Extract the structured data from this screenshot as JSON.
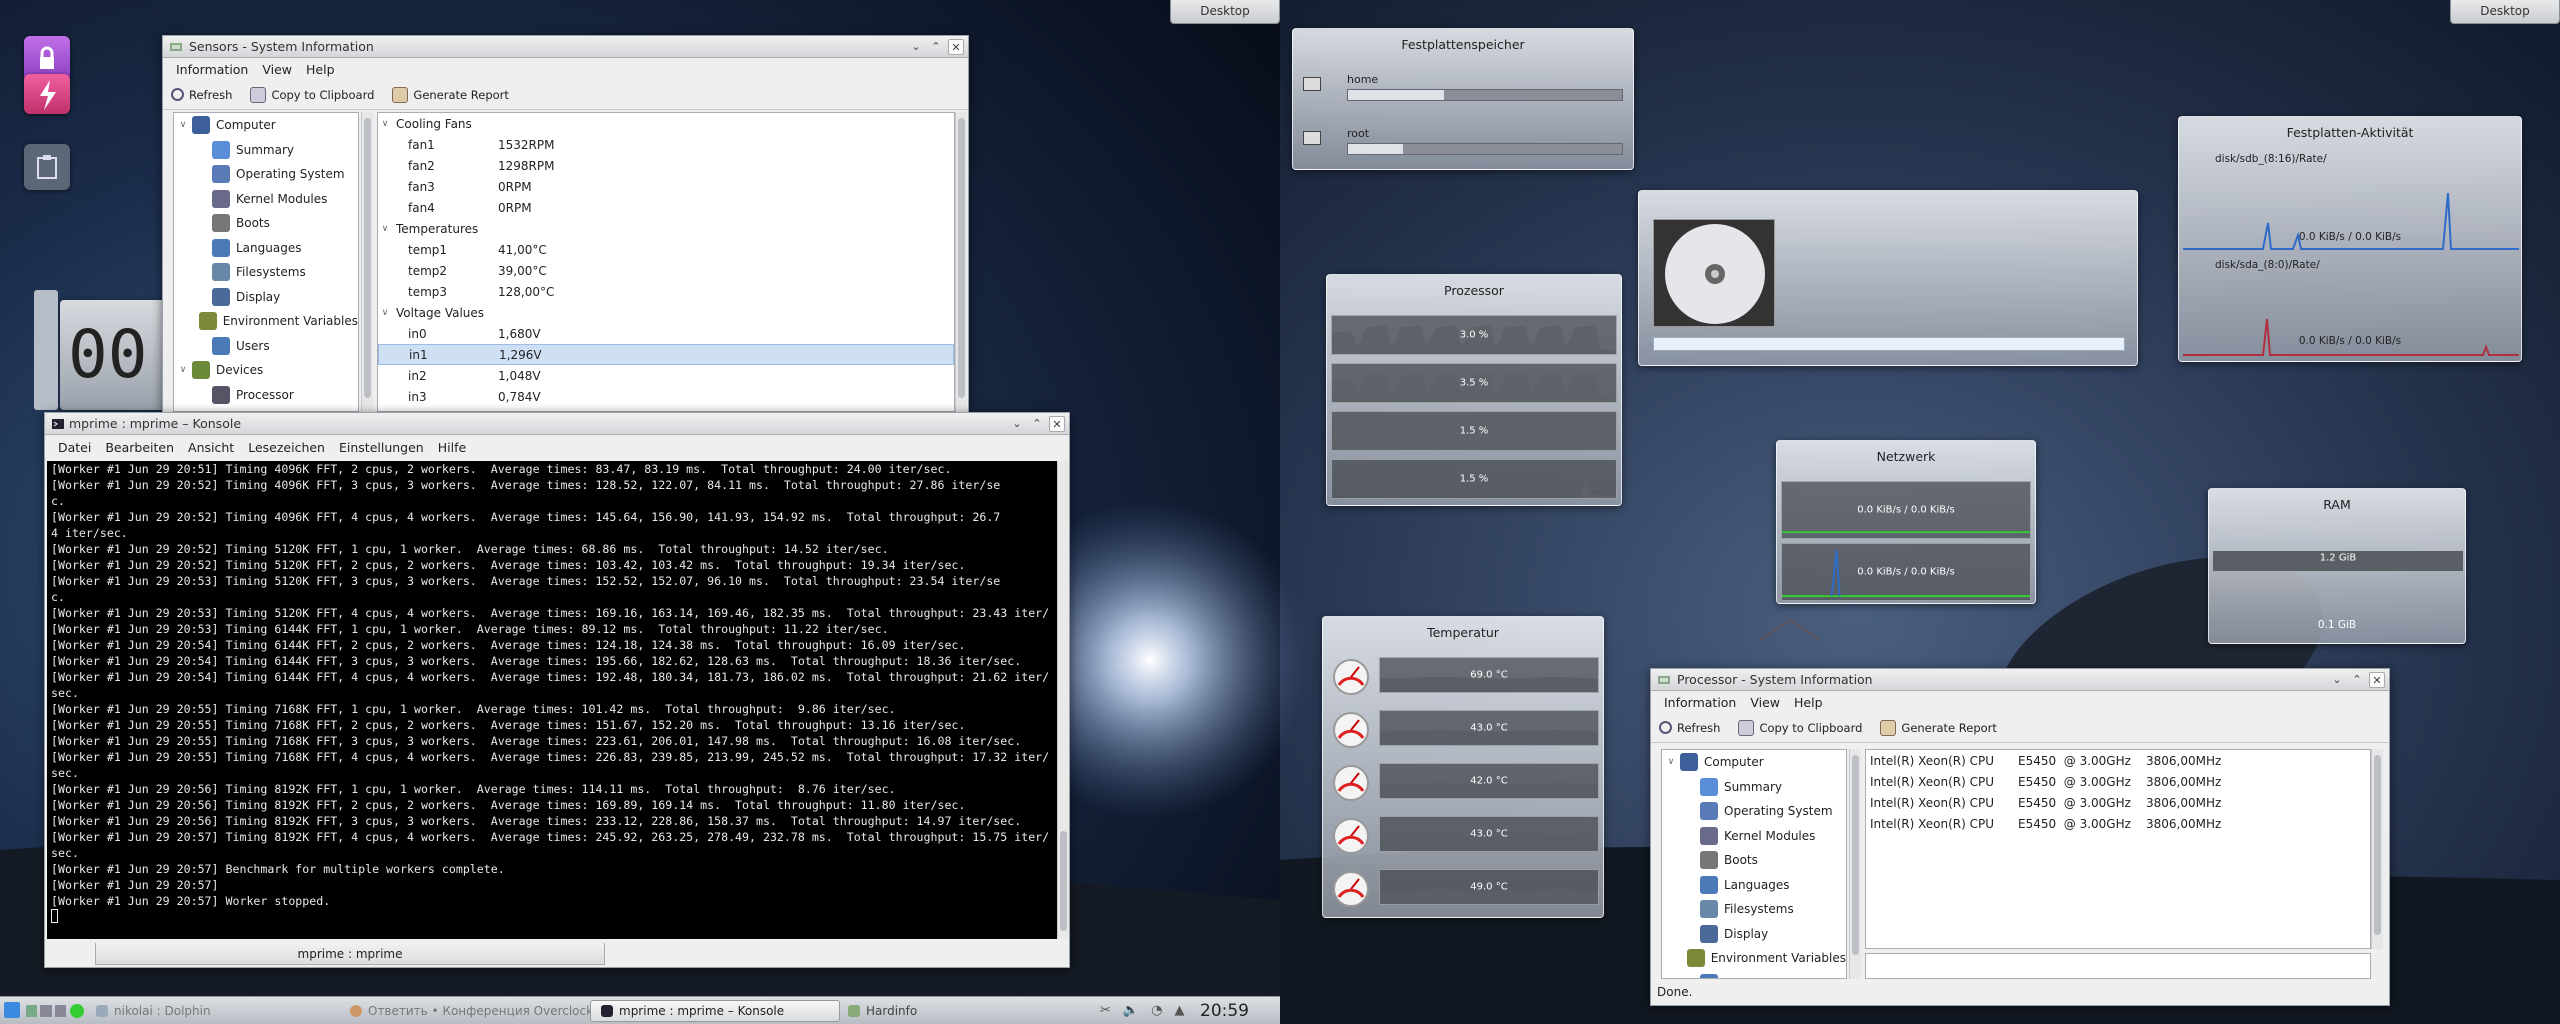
{
  "desktop_buttons": [
    "Desktop",
    "Desktop"
  ],
  "sensors_win": {
    "title": "Sensors - System Information",
    "menu": [
      "Information",
      "View",
      "Help"
    ],
    "toolbar": [
      "Refresh",
      "Copy to Clipboard",
      "Generate Report"
    ],
    "tree": [
      {
        "label": "Computer",
        "level": 0,
        "ex": "v"
      },
      {
        "label": "Summary",
        "level": 1
      },
      {
        "label": "Operating System",
        "level": 1
      },
      {
        "label": "Kernel Modules",
        "level": 1
      },
      {
        "label": "Boots",
        "level": 1
      },
      {
        "label": "Languages",
        "level": 1
      },
      {
        "label": "Filesystems",
        "level": 1
      },
      {
        "label": "Display",
        "level": 1
      },
      {
        "label": "Environment Variables",
        "level": 1
      },
      {
        "label": "Users",
        "level": 1
      },
      {
        "label": "Devices",
        "level": 0,
        "ex": "v"
      },
      {
        "label": "Processor",
        "level": 1
      }
    ],
    "sensors": [
      {
        "group": "Cooling Fans"
      },
      {
        "name": "fan1",
        "value": "1532RPM"
      },
      {
        "name": "fan2",
        "value": "1298RPM"
      },
      {
        "name": "fan3",
        "value": "0RPM"
      },
      {
        "name": "fan4",
        "value": "0RPM"
      },
      {
        "group": "Temperatures"
      },
      {
        "name": "temp1",
        "value": "41,00°C"
      },
      {
        "name": "temp2",
        "value": "39,00°C"
      },
      {
        "name": "temp3",
        "value": "128,00°C"
      },
      {
        "group": "Voltage Values"
      },
      {
        "name": "in0",
        "value": "1,680V"
      },
      {
        "name": "in1",
        "value": "1,296V",
        "selected": true
      },
      {
        "name": "in2",
        "value": "1,048V"
      },
      {
        "name": "in3",
        "value": "0,784V"
      }
    ]
  },
  "konsole": {
    "title": "mprime : mprime – Konsole",
    "menu": [
      "Datei",
      "Bearbeiten",
      "Ansicht",
      "Lesezeichen",
      "Einstellungen",
      "Hilfe"
    ],
    "tab": "mprime : mprime",
    "lines": [
      "[Worker #1 Jun 29 20:51] Timing 4096K FFT, 2 cpus, 2 workers.  Average times: 83.47, 83.19 ms.  Total throughput: 24.00 iter/sec.",
      "[Worker #1 Jun 29 20:52] Timing 4096K FFT, 3 cpus, 3 workers.  Average times: 128.52, 122.07, 84.11 ms.  Total throughput: 27.86 iter/se",
      "c.",
      "[Worker #1 Jun 29 20:52] Timing 4096K FFT, 4 cpus, 4 workers.  Average times: 145.64, 156.90, 141.93, 154.92 ms.  Total throughput: 26.7",
      "4 iter/sec.",
      "[Worker #1 Jun 29 20:52] Timing 5120K FFT, 1 cpu, 1 worker.  Average times: 68.86 ms.  Total throughput: 14.52 iter/sec.",
      "[Worker #1 Jun 29 20:52] Timing 5120K FFT, 2 cpus, 2 workers.  Average times: 103.42, 103.42 ms.  Total throughput: 19.34 iter/sec.",
      "[Worker #1 Jun 29 20:53] Timing 5120K FFT, 3 cpus, 3 workers.  Average times: 152.52, 152.07, 96.10 ms.  Total throughput: 23.54 iter/se",
      "c.",
      "[Worker #1 Jun 29 20:53] Timing 5120K FFT, 4 cpus, 4 workers.  Average times: 169.16, 163.14, 169.46, 182.35 ms.  Total throughput: 23.43 iter/",
      "[Worker #1 Jun 29 20:53] Timing 6144K FFT, 1 cpu, 1 worker.  Average times: 89.12 ms.  Total throughput: 11.22 iter/sec.",
      "[Worker #1 Jun 29 20:54] Timing 6144K FFT, 2 cpus, 2 workers.  Average times: 124.18, 124.38 ms.  Total throughput: 16.09 iter/sec.",
      "[Worker #1 Jun 29 20:54] Timing 6144K FFT, 3 cpus, 3 workers.  Average times: 195.66, 182.62, 128.63 ms.  Total throughput: 18.36 iter/sec.",
      "[Worker #1 Jun 29 20:54] Timing 6144K FFT, 4 cpus, 4 workers.  Average times: 192.48, 180.34, 181.73, 186.02 ms.  Total throughput: 21.62 iter/",
      "sec.",
      "[Worker #1 Jun 29 20:55] Timing 7168K FFT, 1 cpu, 1 worker.  Average times: 101.42 ms.  Total throughput:  9.86 iter/sec.",
      "[Worker #1 Jun 29 20:55] Timing 7168K FFT, 2 cpus, 2 workers.  Average times: 151.67, 152.20 ms.  Total throughput: 13.16 iter/sec.",
      "[Worker #1 Jun 29 20:55] Timing 7168K FFT, 3 cpus, 3 workers.  Average times: 223.61, 206.01, 147.98 ms.  Total throughput: 16.08 iter/sec.",
      "[Worker #1 Jun 29 20:55] Timing 7168K FFT, 4 cpus, 4 workers.  Average times: 226.83, 239.85, 213.99, 245.52 ms.  Total throughput: 17.32 iter/",
      "sec.",
      "[Worker #1 Jun 29 20:56] Timing 8192K FFT, 1 cpu, 1 worker.  Average times: 114.11 ms.  Total throughput:  8.76 iter/sec.",
      "[Worker #1 Jun 29 20:56] Timing 8192K FFT, 2 cpus, 2 workers.  Average times: 169.89, 169.14 ms.  Total throughput: 11.80 iter/sec.",
      "[Worker #1 Jun 29 20:56] Timing 8192K FFT, 3 cpus, 3 workers.  Average times: 233.12, 228.86, 158.37 ms.  Total throughput: 14.97 iter/sec.",
      "[Worker #1 Jun 29 20:57] Timing 8192K FFT, 4 cpus, 4 workers.  Average times: 245.92, 263.25, 278.49, 232.78 ms.  Total throughput: 15.75 iter/",
      "sec.",
      "[Worker #1 Jun 29 20:57] Benchmark for multiple workers complete.",
      "[Worker #1 Jun 29 20:57]",
      "[Worker #1 Jun 29 20:57] Worker stopped.",
      ""
    ]
  },
  "taskbar": {
    "tasks": [
      "nikolai : Dolphin",
      "Ответить • Конференция Overclock...",
      "mprime : mprime – Konsole",
      "Hardinfo"
    ],
    "clock": "20:59"
  },
  "widgets": {
    "disk_space": {
      "title": "Festplattenspeicher",
      "items": [
        {
          "name": "home",
          "fill": 0.35
        },
        {
          "name": "root",
          "fill": 0.2
        }
      ]
    },
    "disk_activity": {
      "title": "Festplatten-Aktivität",
      "items": [
        {
          "name": "disk/sdb_(8:16)/Rate/",
          "rate": "0.0 KiB/s / 0.0 KiB/s"
        },
        {
          "name": "disk/sda_(8:0)/Rate/",
          "rate": "0.0 KiB/s / 0.0 KiB/s"
        }
      ]
    },
    "cpu": {
      "title": "Prozessor",
      "values": [
        "3.0 %",
        "3.5 %",
        "1.5 %",
        "1.5 %"
      ]
    },
    "network": {
      "title": "Netzwerk",
      "values": [
        "0.0 KiB/s / 0.0 KiB/s",
        "0.0 KiB/s / 0.0 KiB/s"
      ]
    },
    "ram": {
      "title": "RAM",
      "values": [
        "1.2 GiB",
        "0.1 GiB"
      ]
    },
    "temp": {
      "title": "Temperatur",
      "values": [
        "69.0 °C",
        "43.0 °C",
        "42.0 °C",
        "43.0 °C",
        "49.0 °C"
      ]
    },
    "media": {
      "progress": 0
    }
  },
  "processor_win": {
    "title": "Processor - System Information",
    "menu": [
      "Information",
      "View",
      "Help"
    ],
    "toolbar": [
      "Refresh",
      "Copy to Clipboard",
      "Generate Report"
    ],
    "tree": [
      {
        "label": "Computer",
        "level": 0,
        "ex": "v"
      },
      {
        "label": "Summary",
        "level": 1
      },
      {
        "label": "Operating System",
        "level": 1
      },
      {
        "label": "Kernel Modules",
        "level": 1
      },
      {
        "label": "Boots",
        "level": 1
      },
      {
        "label": "Languages",
        "level": 1
      },
      {
        "label": "Filesystems",
        "level": 1
      },
      {
        "label": "Display",
        "level": 1
      },
      {
        "label": "Environment Variables",
        "level": 1
      },
      {
        "label": "Users",
        "level": 1
      }
    ],
    "cpus": [
      {
        "model": "Intel(R) Xeon(R) CPU",
        "spec": "E5450  @ 3.00GHz",
        "freq": "3806,00MHz"
      },
      {
        "model": "Intel(R) Xeon(R) CPU",
        "spec": "E5450  @ 3.00GHz",
        "freq": "3806,00MHz"
      },
      {
        "model": "Intel(R) Xeon(R) CPU",
        "spec": "E5450  @ 3.00GHz",
        "freq": "3806,00MHz"
      },
      {
        "model": "Intel(R) Xeon(R) CPU",
        "spec": "E5450  @ 3.00GHz",
        "freq": "3806,00MHz"
      }
    ],
    "status": "Done."
  },
  "side_clock_fragment": "00"
}
